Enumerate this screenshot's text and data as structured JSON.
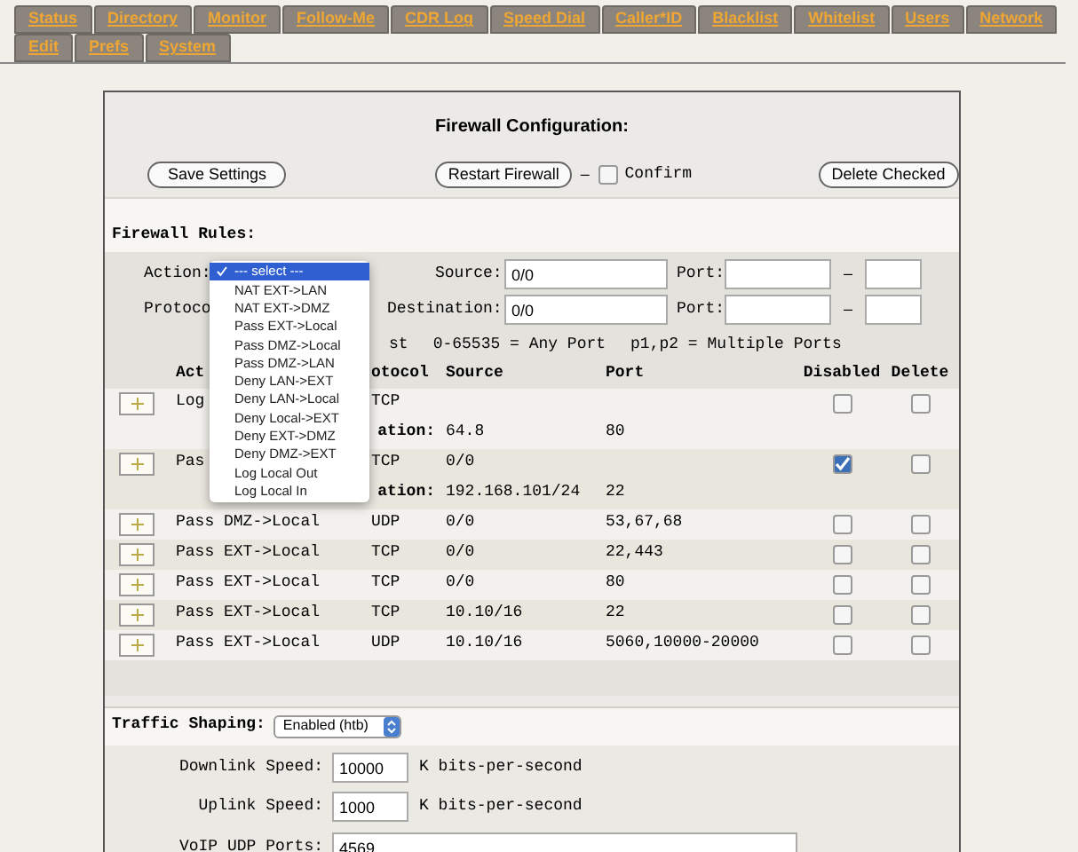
{
  "tabs": [
    {
      "label": "Status"
    },
    {
      "label": "Directory"
    },
    {
      "label": "Monitor"
    },
    {
      "label": "Follow-Me"
    },
    {
      "label": "CDR Log"
    },
    {
      "label": "Speed Dial"
    },
    {
      "label": "Caller*ID"
    },
    {
      "label": "Blacklist"
    },
    {
      "label": "Whitelist"
    },
    {
      "label": "Users"
    },
    {
      "label": "Network"
    },
    {
      "label": "Edit"
    },
    {
      "label": "Prefs"
    },
    {
      "label": "System"
    }
  ],
  "title": "Firewall Configuration:",
  "buttons": {
    "save": "Save Settings",
    "restart": "Restart Firewall",
    "dash": "–",
    "confirm": {
      "label": "Confirm",
      "checked": false
    },
    "delete": "Delete Checked"
  },
  "rules_heading": "Firewall Rules:",
  "form": {
    "action_label": "Action:",
    "protocol_label": "Protoco",
    "source_label": "Source:",
    "source_value": "0/0",
    "destination_label": "Destination:",
    "destination_value": "0/0",
    "port_label": "Port:",
    "port_label_2": "Port:",
    "port_dash": "–",
    "port_dash_2": "–",
    "legend": [
      "st",
      "0-65535 = Any Port",
      "p1,p2 = Multiple Ports"
    ]
  },
  "action_menu": {
    "items": [
      {
        "label": "--- select ---",
        "selected": true
      },
      {
        "label": "NAT EXT->LAN",
        "selected": false
      },
      {
        "label": "NAT EXT->DMZ",
        "selected": false
      },
      {
        "label": "Pass EXT->Local",
        "selected": false
      },
      {
        "label": "Pass DMZ->Local",
        "selected": false
      },
      {
        "label": "Pass DMZ->LAN",
        "selected": false
      },
      {
        "label": "Deny LAN->EXT",
        "selected": false
      },
      {
        "label": "Deny LAN->Local",
        "selected": false
      },
      {
        "label": "Deny Local->EXT",
        "selected": false
      },
      {
        "label": "Deny EXT->DMZ",
        "selected": false
      },
      {
        "label": "Deny DMZ->EXT",
        "selected": false
      },
      {
        "label": "Log Local Out",
        "selected": false
      },
      {
        "label": "Log Local In",
        "selected": false
      }
    ]
  },
  "table": {
    "columns": [
      "Act",
      "otocol",
      "Source",
      "Port",
      "Disabled",
      "Delete"
    ],
    "rows": [
      {
        "action": "Log",
        "protocol": "TCP",
        "source": "",
        "port": "",
        "disabled": false,
        "delete": false,
        "destination": {
          "label": "ation:",
          "source": "64.8",
          "port": "80"
        }
      },
      {
        "action": "Pas",
        "protocol": "TCP",
        "source": "0/0",
        "port": "",
        "disabled": true,
        "delete": false,
        "destination": {
          "label": "ation:",
          "source": "192.168.101/24",
          "port": "22"
        }
      },
      {
        "action": "Pass DMZ->Local",
        "protocol": "UDP",
        "source": "0/0",
        "port": "53,67,68",
        "disabled": false,
        "delete": false
      },
      {
        "action": "Pass EXT->Local",
        "protocol": "TCP",
        "source": "0/0",
        "port": "22,443",
        "disabled": false,
        "delete": false
      },
      {
        "action": "Pass EXT->Local",
        "protocol": "TCP",
        "source": "0/0",
        "port": "80",
        "disabled": false,
        "delete": false
      },
      {
        "action": "Pass EXT->Local",
        "protocol": "TCP",
        "source": "10.10/16",
        "port": "22",
        "disabled": false,
        "delete": false
      },
      {
        "action": "Pass EXT->Local",
        "protocol": "UDP",
        "source": "10.10/16",
        "port": "5060,10000-20000",
        "disabled": false,
        "delete": false
      }
    ]
  },
  "traffic_shaping": {
    "label": "Traffic Shaping:",
    "value": "Enabled (htb)",
    "downlink_label": "Downlink Speed:",
    "downlink_value": "10000",
    "uplink_label": "Uplink Speed:",
    "uplink_value": "1000",
    "unit": "K bits-per-second",
    "unit2": "K bits-per-second",
    "voip_label": "VoIP UDP Ports:",
    "voip_value": "4569"
  }
}
